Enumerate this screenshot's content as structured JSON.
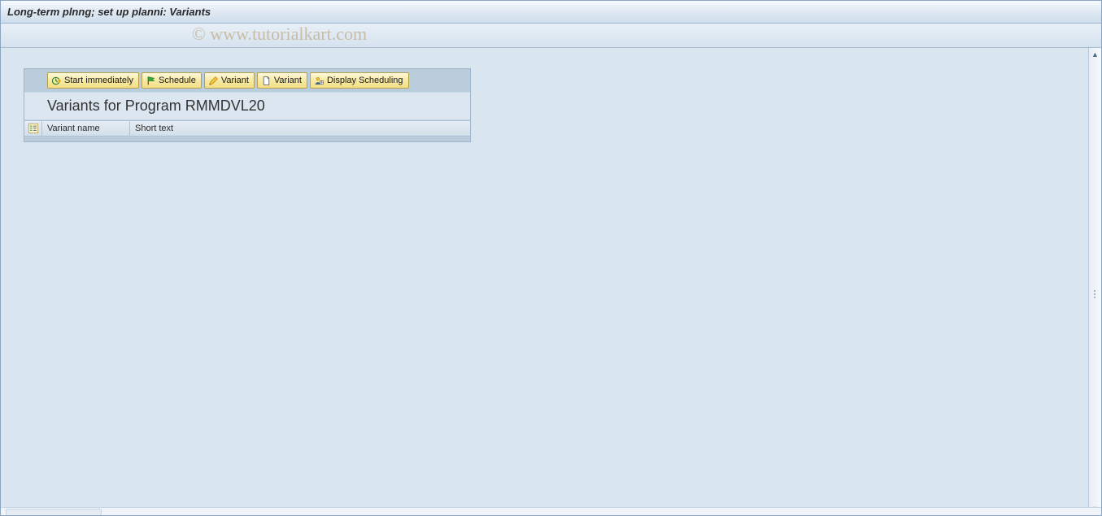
{
  "header": {
    "title": "Long-term plnng; set up planni: Variants"
  },
  "watermark": "© www.tutorialkart.com",
  "panel": {
    "toolbar": {
      "start_immediately": "Start immediately",
      "schedule": "Schedule",
      "variant_edit": "Variant",
      "variant_new": "Variant",
      "display_scheduling": "Display Scheduling"
    },
    "heading": "Variants for Program RMMDVL20",
    "columns": {
      "variant_name": "Variant name",
      "short_text": "Short text"
    },
    "rows": []
  }
}
